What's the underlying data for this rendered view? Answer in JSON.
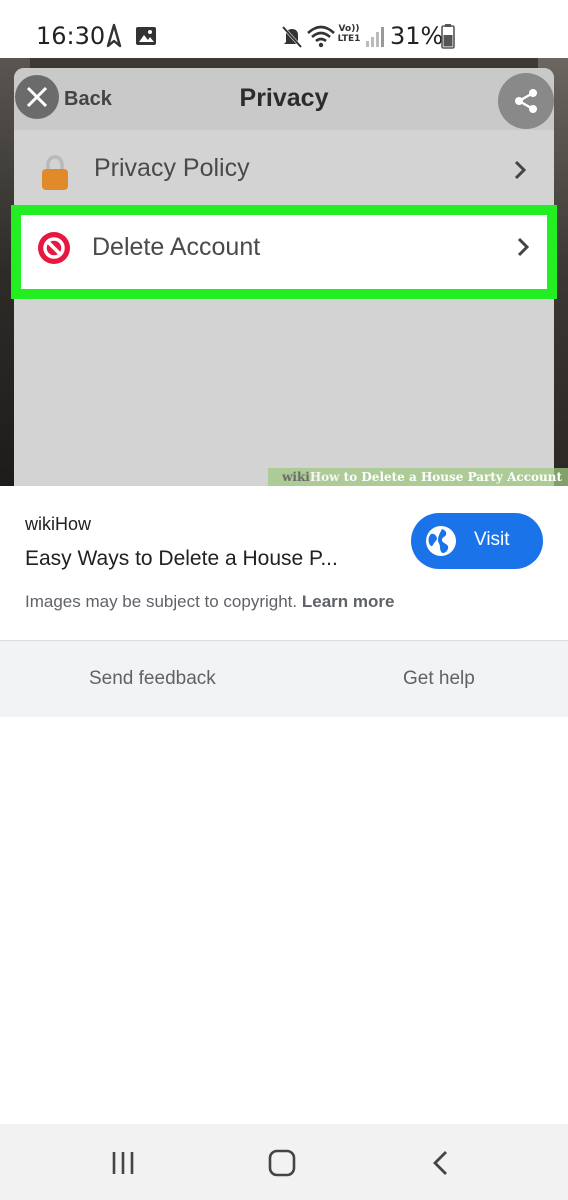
{
  "status_bar": {
    "time": "16:30",
    "battery": "31%",
    "network_label_top": "Vo))",
    "network_label_bottom": "LTE1"
  },
  "screenshot_image": {
    "app_header": {
      "back_label": "Back",
      "title": "Privacy"
    },
    "rows": [
      {
        "label": "Privacy Policy",
        "icon": "lock-icon"
      },
      {
        "label": "Delete Account",
        "icon": "prohibited-icon"
      }
    ],
    "watermark": {
      "prefix": "wiki",
      "how": "How",
      "text": " to Delete a House Party Account"
    }
  },
  "result": {
    "source": "wikiHow",
    "title": "Easy Ways to Delete a House P...",
    "visit_label": "Visit",
    "copyright_text": "Images may be subject to copyright. ",
    "learn_more": "Learn more"
  },
  "footer": {
    "send_feedback": "Send feedback",
    "get_help": "Get help"
  },
  "colors": {
    "accent": "#1a73e8",
    "highlight": "#22ee22",
    "lock": "#e08a2a",
    "prohibited": "#e8173f"
  }
}
